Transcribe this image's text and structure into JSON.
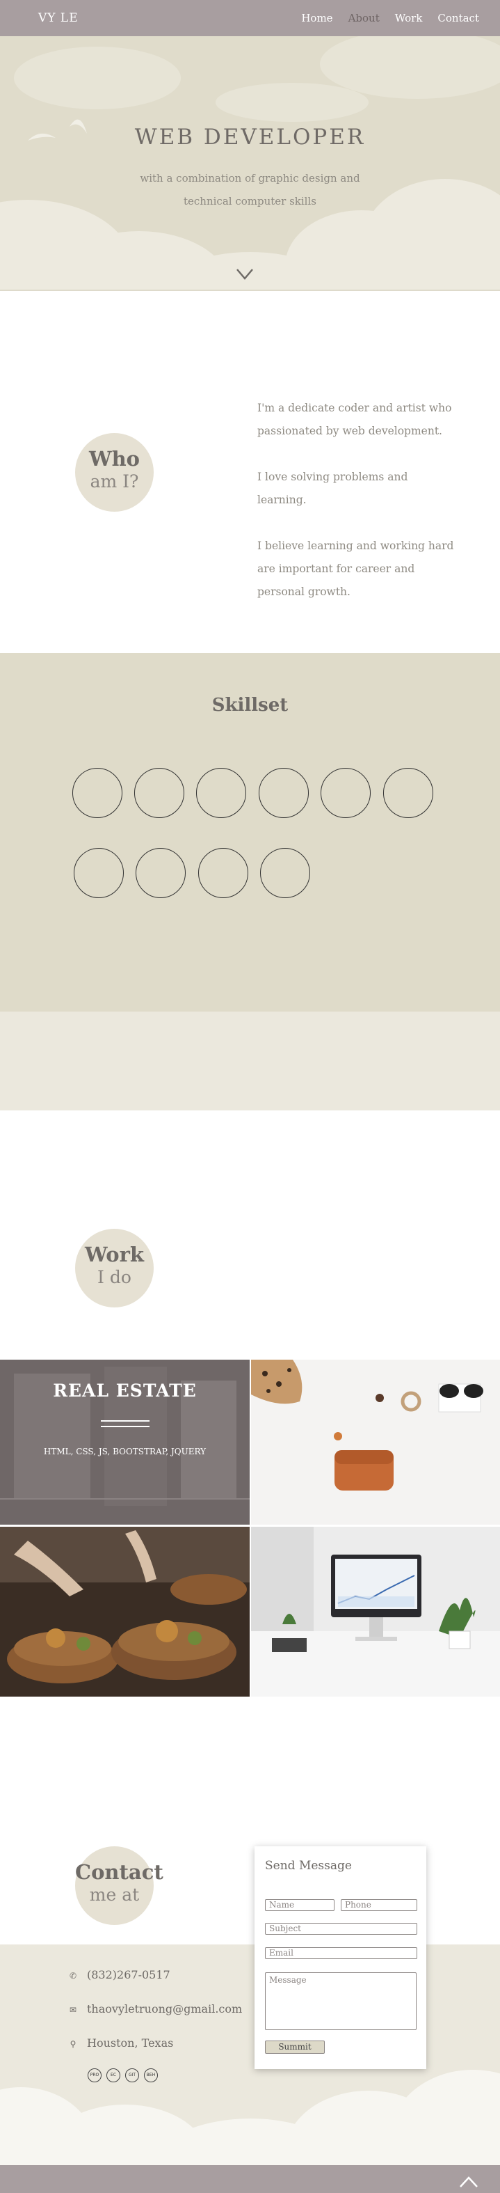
{
  "nav": {
    "brand": "VY LE",
    "links": [
      "Home",
      "About",
      "Work",
      "Contact"
    ],
    "active": "About"
  },
  "hero": {
    "title": "WEB DEVELOPER",
    "subtitle_line1": "with a combination of graphic design and",
    "subtitle_line2": "technical computer skills",
    "scroll_icon": "chevron-down-icon"
  },
  "about": {
    "heading_1": "Who",
    "heading_2": "am I?",
    "paragraphs": [
      "I'm a dedicate coder and artist who passionated by web development.",
      "I love solving problems and learning.",
      "I believe learning and working hard are important for career and personal growth."
    ]
  },
  "skills": {
    "title": "Skillset"
  },
  "work": {
    "heading_1": "Work",
    "heading_2": "I do",
    "projects": [
      {
        "title": "REAL ESTATE",
        "tech": "HTML, CSS, JS, BOOTSTRAP, JQUERY"
      }
    ]
  },
  "contact": {
    "heading_1": "Contact",
    "heading_2": "me at",
    "phone": "(832)267-0517",
    "email": "thaovyletruong@gmail.com",
    "location": "Houston, Texas",
    "social": [
      "PRO",
      "EC",
      "GIT",
      "BEH"
    ],
    "form": {
      "title": "Send Message",
      "name_placeholder": "Name",
      "phone_placeholder": "Phone",
      "subject_placeholder": "Subject",
      "email_placeholder": "Email",
      "message_placeholder": "Message",
      "submit_label": "Summit"
    }
  },
  "colors": {
    "nav": "#a89ea0",
    "hero": "#e0dccb",
    "skills": "#dfdbc9",
    "band": "#ebe8dd"
  }
}
